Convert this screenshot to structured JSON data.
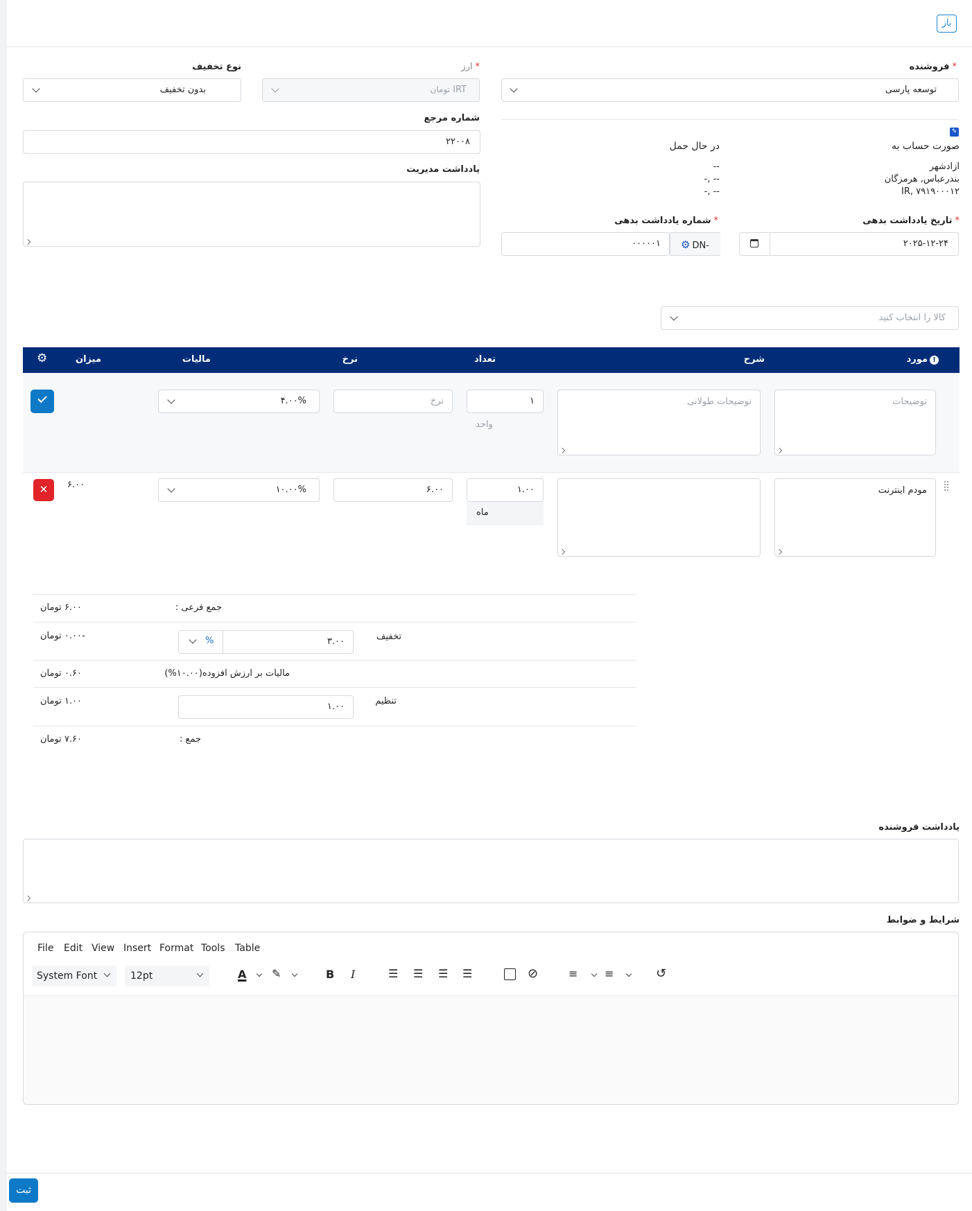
{
  "header": {
    "open_label": "باز"
  },
  "vendor": {
    "label": "فروشنده",
    "value": "توسعه پارسی"
  },
  "currency": {
    "label": "ارز",
    "value": "IRT",
    "unit": "تومان"
  },
  "discount_type": {
    "label": "نوع تخفیف",
    "value": "بدون تخفیف"
  },
  "reference": {
    "label": "شماره مرجع",
    "value": "۲۲۰۰۸"
  },
  "admin_note": {
    "label": "یادداشت مدیریت"
  },
  "bill_to": {
    "label": "صورت حساب به",
    "lines": [
      "ازادشهر",
      "بندرعباس, هرمزگان",
      "IR, ۷۹۱۹۰۰۰۱۲"
    ]
  },
  "ship_to": {
    "label": "در حال حمل",
    "lines": [
      "--",
      "-- ,-",
      "-- ,-"
    ]
  },
  "debit_date": {
    "label": "تاریخ یادداشت بدهی",
    "value": "۲۰۲۵-۱۲-۲۴"
  },
  "debit_number": {
    "label": "شماره یادداشت بدهی",
    "prefix": "DN-",
    "value": "۰۰۰۰۰۱"
  },
  "item_select": {
    "placeholder": "کالا را انتخاب کنید"
  },
  "table": {
    "headers": {
      "item": "مورد",
      "desc": "شرح",
      "qty": "تعداد",
      "rate": "نرخ",
      "tax": "مالیات",
      "amount": "میزان"
    },
    "new_row": {
      "item_ph": "توضیحات",
      "desc_ph": "توضیحات طولانی",
      "qty": "۱",
      "unit_ph": "واحد",
      "rate_ph": "نرخ",
      "tax": "۴.۰۰%"
    },
    "row1": {
      "item": "مودم اینترنت",
      "qty": "۱.۰۰",
      "unit": "ماه",
      "rate": "۶.۰۰",
      "tax": "۱۰.۰۰%",
      "amount": "۶.۰۰"
    }
  },
  "totals": {
    "subtotal_label": "جمع فرعی :",
    "subtotal": "۶.۰۰ تومان",
    "discount_label": "تخفیف",
    "discount_input": "۳.۰۰",
    "discount_unit": "%",
    "discount": "-۰.۰۰ تومان",
    "vat_label": "مالیات بر ارزش افزوده(۱۰.۰۰%)",
    "vat": "۰.۶۰ تومان",
    "adjust_label": "تنظیم",
    "adjust_input": "۱.۰۰",
    "adjust": "۱.۰۰ تومان",
    "total_label": "جمع :",
    "total": "۷.۶۰ تومان"
  },
  "vendor_note": {
    "label": "یادداشت فروشنده"
  },
  "terms": {
    "label": "شرایط و ضوابط"
  },
  "editor": {
    "menus": [
      "File",
      "Edit",
      "View",
      "Insert",
      "Format",
      "Tools",
      "Table"
    ],
    "font": "System Font",
    "size": "12pt"
  },
  "footer": {
    "submit_label": "ثبت"
  }
}
